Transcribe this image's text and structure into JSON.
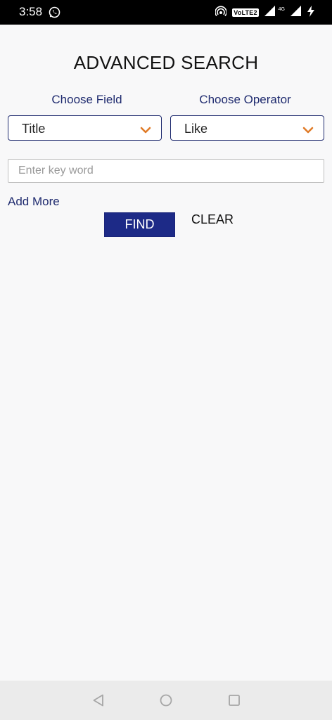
{
  "status_bar": {
    "time": "3:58",
    "volte": "VoLTE2",
    "network": "4G",
    "icons": [
      "whatsapp-icon",
      "hotspot-icon",
      "signal-icon",
      "charging-icon"
    ]
  },
  "page": {
    "title": "ADVANCED SEARCH"
  },
  "filters": {
    "field_label": "Choose Field",
    "field_value": "Title",
    "operator_label": "Choose Operator",
    "operator_value": "Like",
    "chevron_color": "#e07b28"
  },
  "search": {
    "placeholder": "Enter key word",
    "value": ""
  },
  "actions": {
    "add_more": "Add More",
    "find": "FIND",
    "clear": "CLEAR"
  },
  "nav_bar": {
    "icons": [
      "back-icon",
      "home-icon",
      "recents-icon"
    ]
  },
  "colors": {
    "accent": "#1f2b6f",
    "find_button_bg": "#1d2a87",
    "background": "#f8f8f9"
  }
}
